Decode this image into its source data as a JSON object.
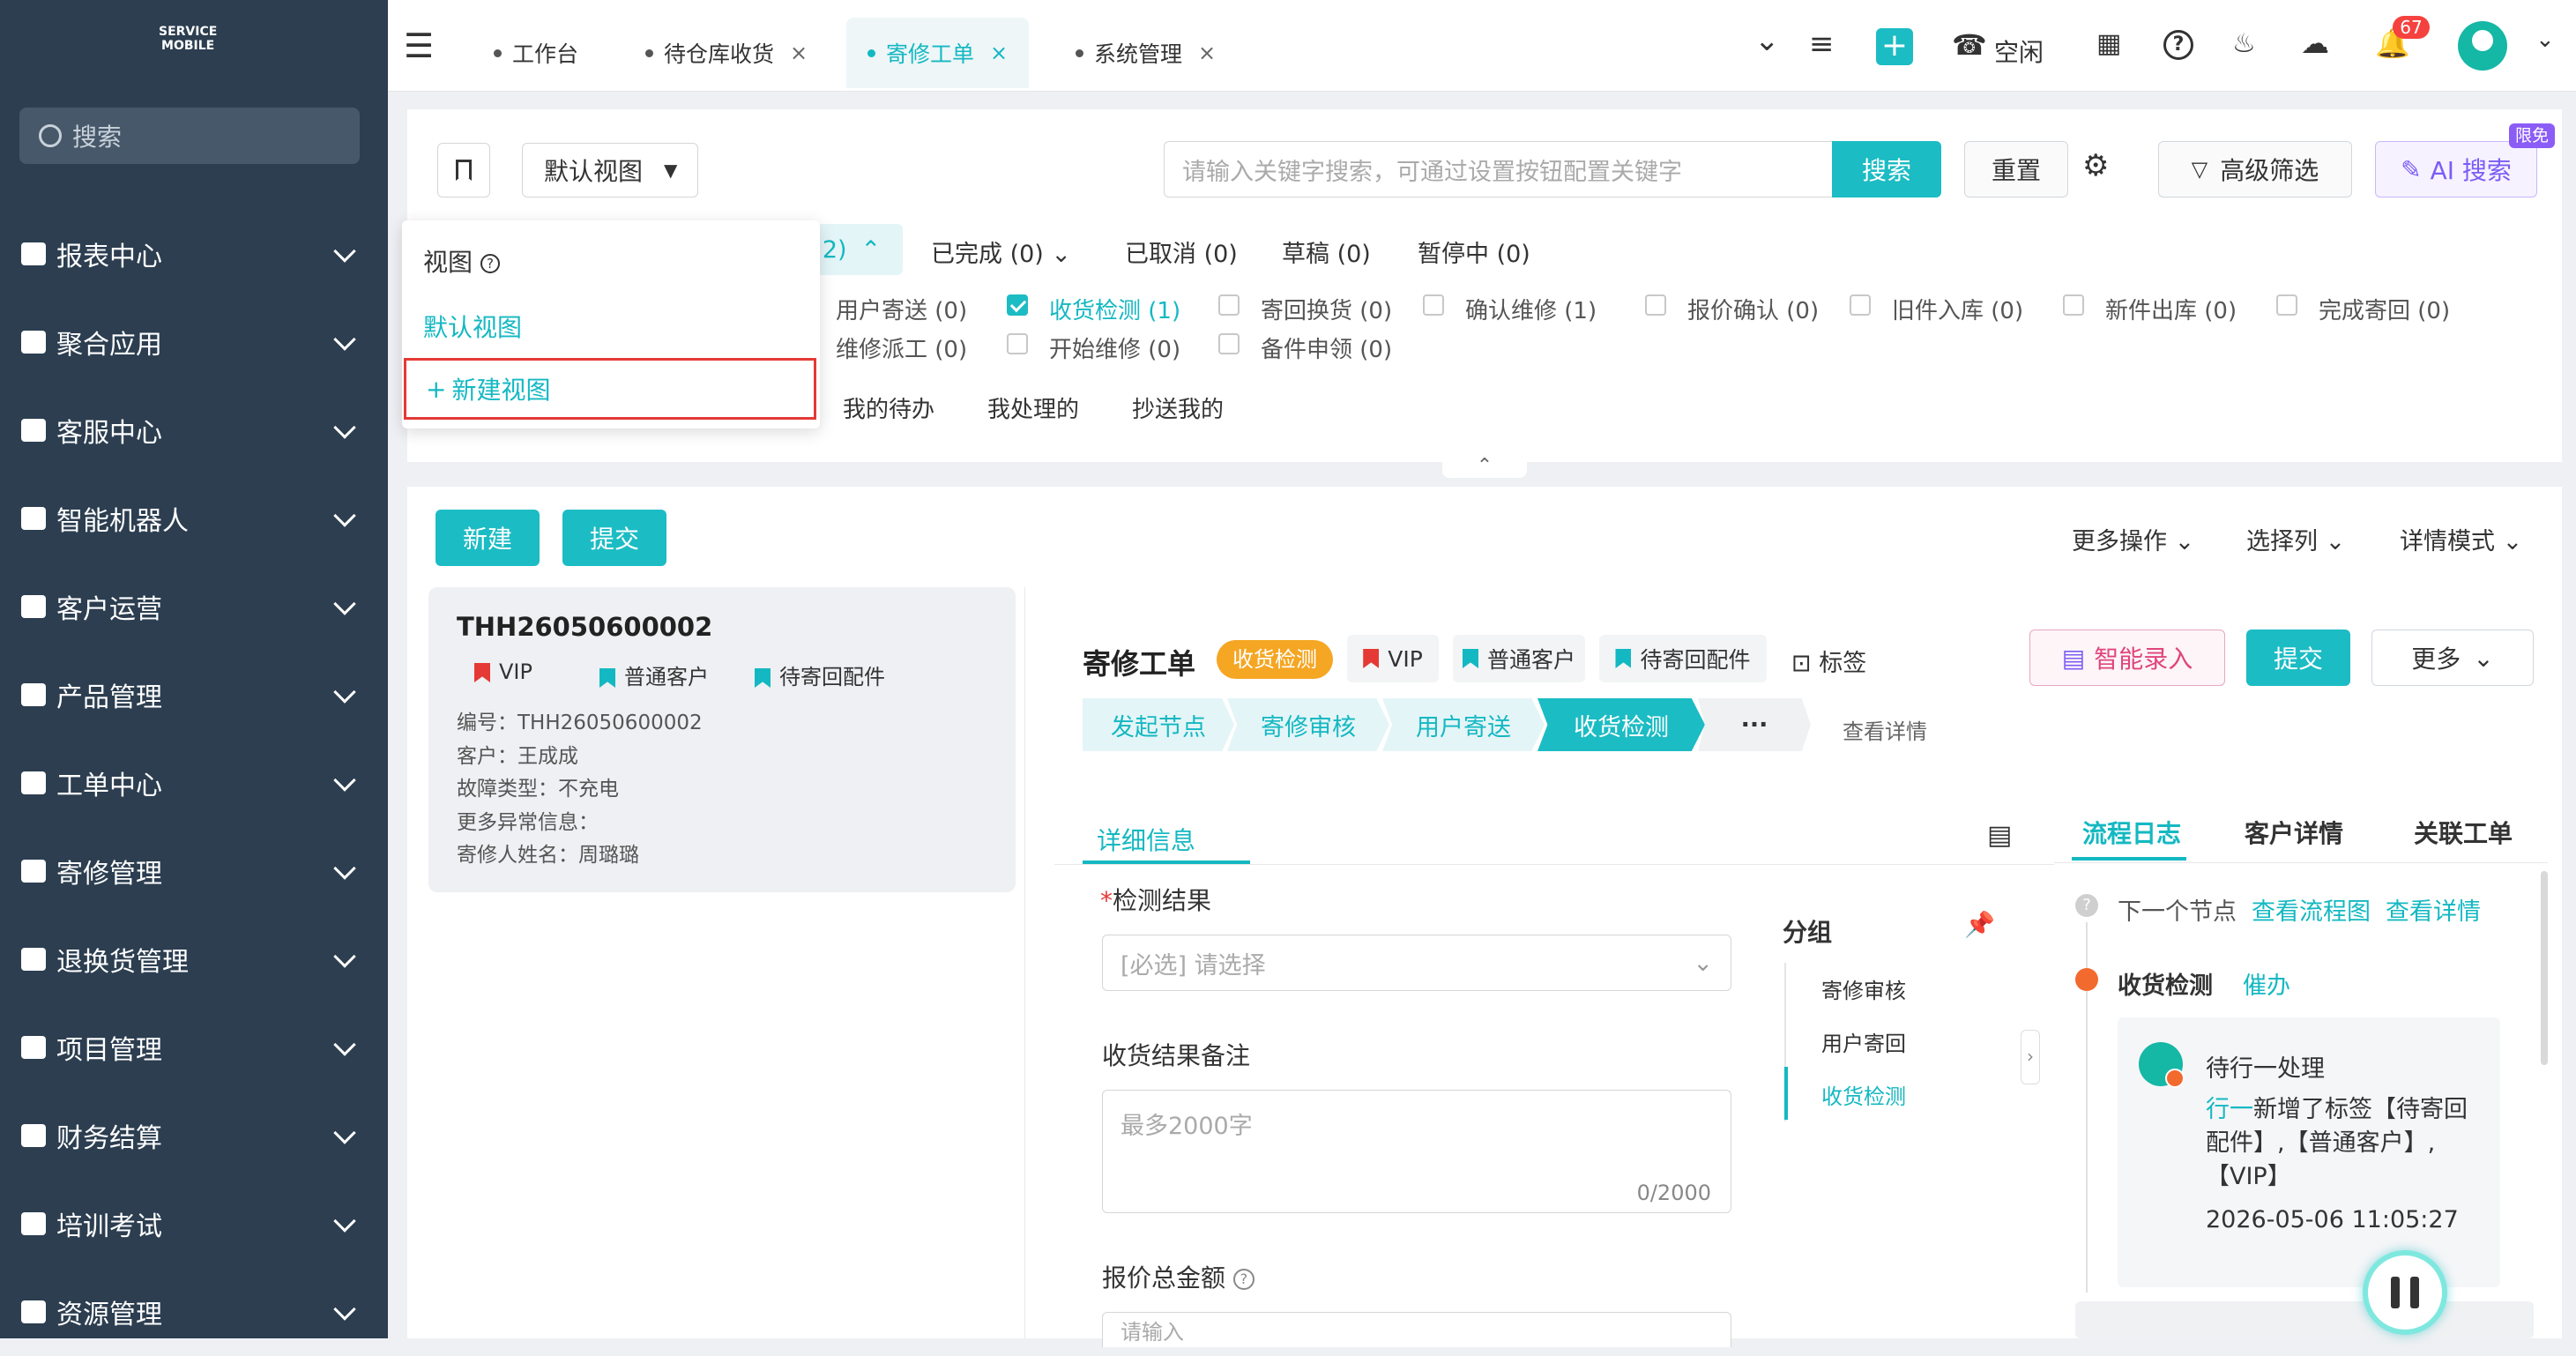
{
  "brand": {
    "logo_text": "SERVICE MOBILE",
    "accent": "#1cbcc4"
  },
  "sidebar": {
    "search_placeholder": "搜索",
    "items": [
      {
        "label": "报表中心",
        "icon": "report-icon"
      },
      {
        "label": "聚合应用",
        "icon": "sitemap-icon"
      },
      {
        "label": "客服中心",
        "icon": "home-icon"
      },
      {
        "label": "智能机器人",
        "icon": "ai-icon"
      },
      {
        "label": "客户运营",
        "icon": "contact-icon"
      },
      {
        "label": "产品管理",
        "icon": "box-icon"
      },
      {
        "label": "工单中心",
        "icon": "ticket-icon"
      },
      {
        "label": "寄修管理",
        "icon": "card-icon"
      },
      {
        "label": "退换货管理",
        "icon": "sitemap-icon"
      },
      {
        "label": "项目管理",
        "icon": "project-icon"
      },
      {
        "label": "财务结算",
        "icon": "yen-icon"
      },
      {
        "label": "培训考试",
        "icon": "graduation-icon"
      },
      {
        "label": "资源管理",
        "icon": "resource-icon"
      }
    ]
  },
  "tabs": [
    {
      "label": "工作台",
      "closable": false
    },
    {
      "label": "待仓库收货",
      "closable": true
    },
    {
      "label": "寄修工单",
      "closable": true,
      "active": true
    },
    {
      "label": "系统管理",
      "closable": true
    }
  ],
  "topbar": {
    "status": "空闲",
    "notification_count": "67"
  },
  "filter": {
    "view_select": "默认视图",
    "search_placeholder": "请输入关键字搜索，可通过设置按钮配置关键字",
    "search_btn": "搜索",
    "reset_btn": "重置",
    "advanced_btn": "高级筛选",
    "ai_btn": "AI 搜索",
    "ai_badge": "限免",
    "status_tabs": [
      "2)",
      "已完成 (0)",
      "已取消 (0)",
      "草稿 (0)",
      "暂停中 (0)"
    ],
    "sub_row1": [
      {
        "label": "用户寄送 (0)",
        "checked": false,
        "no_box": true
      },
      {
        "label": "收货检测 (1)",
        "checked": true
      },
      {
        "label": "寄回换货 (0)",
        "checked": false
      },
      {
        "label": "确认维修 (1)",
        "checked": false
      },
      {
        "label": "报价确认 (0)",
        "checked": false
      },
      {
        "label": "旧件入库 (0)",
        "checked": false
      },
      {
        "label": "新件出库 (0)",
        "checked": false
      },
      {
        "label": "完成寄回 (0)",
        "checked": false
      }
    ],
    "sub_row2": [
      {
        "label": "维修派工 (0)",
        "checked": false,
        "no_box": true
      },
      {
        "label": "开始维修 (0)",
        "checked": false
      },
      {
        "label": "备件申领 (0)",
        "checked": false
      }
    ],
    "scope_tabs": [
      "我的待办",
      "我处理的",
      "抄送我的"
    ]
  },
  "view_dropdown": {
    "title": "视图",
    "items": [
      "默认视图"
    ],
    "new_view": "新建视图"
  },
  "toolbar": {
    "new_btn": "新建",
    "submit_btn": "提交",
    "more_ops": "更多操作",
    "select_cols": "选择列",
    "detail_mode": "详情模式"
  },
  "card": {
    "id": "THH26050600002",
    "tags": [
      "VIP",
      "普通客户",
      "待寄回配件"
    ],
    "fields": [
      "编号：THH26050600002",
      "客户：王成成",
      "故障类型：不充电",
      "更多异常信息：",
      "寄修人姓名：周璐璐"
    ]
  },
  "detail": {
    "title": "寄修工单",
    "status_badge": "收货检测",
    "tags": [
      "VIP",
      "普通客户",
      "待寄回配件"
    ],
    "tag_btn": "标签",
    "smart_btn": "智能录入",
    "submit_btn": "提交",
    "more_btn": "更多",
    "steps": [
      "发起节点",
      "寄修审核",
      "用户寄送",
      "收货检测",
      "···"
    ],
    "view_detail": "查看详情",
    "tab": "详细信息",
    "form": {
      "result_label": "检测结果",
      "result_placeholder": "[必选] 请选择",
      "remark_label": "收货结果备注",
      "remark_placeholder": "最多2000字",
      "remark_count": "0/2000",
      "total_label": "报价总金额",
      "total_placeholder": "请输入"
    },
    "group": {
      "title": "分组",
      "items": [
        "寄修审核",
        "用户寄回",
        "收货检测"
      ]
    }
  },
  "right_panel": {
    "tabs": [
      "流程日志",
      "客户详情",
      "关联工单"
    ],
    "next_node": "下一个节点",
    "view_flow": "查看流程图",
    "view_detail": "查看详情",
    "node": "收货检测",
    "urge": "催办",
    "log_user": "待行一处理",
    "log_actor": "行一",
    "log_text": "新增了标签【待寄回配件】,【普通客户】,【VIP】",
    "log_time": "2026-05-06 11:05:27"
  }
}
